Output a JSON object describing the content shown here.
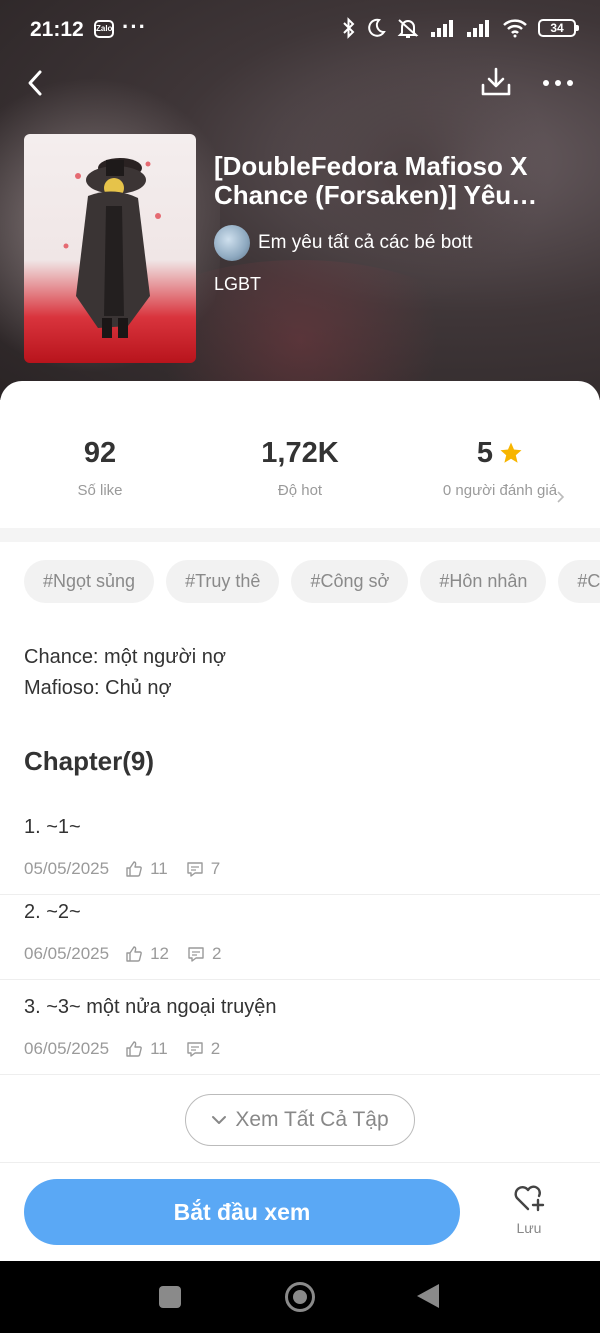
{
  "status": {
    "time": "21:12",
    "zalo": "Zalo",
    "dots": "···",
    "battery": "34"
  },
  "book": {
    "title": "[DoubleFedora Mafioso X Chance (Forsaken)] Yêu Em…",
    "author": "Em yêu tất cả các bé bott",
    "genre": "LGBT"
  },
  "stats": {
    "likes_value": "92",
    "likes_label": "Số like",
    "hot_value": "1,72K",
    "hot_label": "Độ hot",
    "rating_value": "5",
    "rating_label": "0 người đánh giá"
  },
  "tags": [
    "#Ngọt sủng",
    "#Truy thê",
    "#Công sở",
    "#Hôn nhân",
    "#C"
  ],
  "description": {
    "line1": "Chance: một người nợ",
    "line2": "Mafioso: Chủ nợ"
  },
  "chapters_header": "Chapter(9)",
  "chapters": [
    {
      "title": "1. ~1~",
      "date": "05/05/2025",
      "likes": "11",
      "comments": "7"
    },
    {
      "title": "2. ~2~",
      "date": "06/05/2025",
      "likes": "12",
      "comments": "2"
    },
    {
      "title": "3. ~3~ một nửa ngoại truyện",
      "date": "06/05/2025",
      "likes": "11",
      "comments": "2"
    }
  ],
  "see_all": "Xem Tất Cả Tập",
  "start_button": "Bắt đầu xem",
  "save_label": "Lưu",
  "colors": {
    "accent": "#5aa8f5",
    "star": "#f7b500"
  }
}
